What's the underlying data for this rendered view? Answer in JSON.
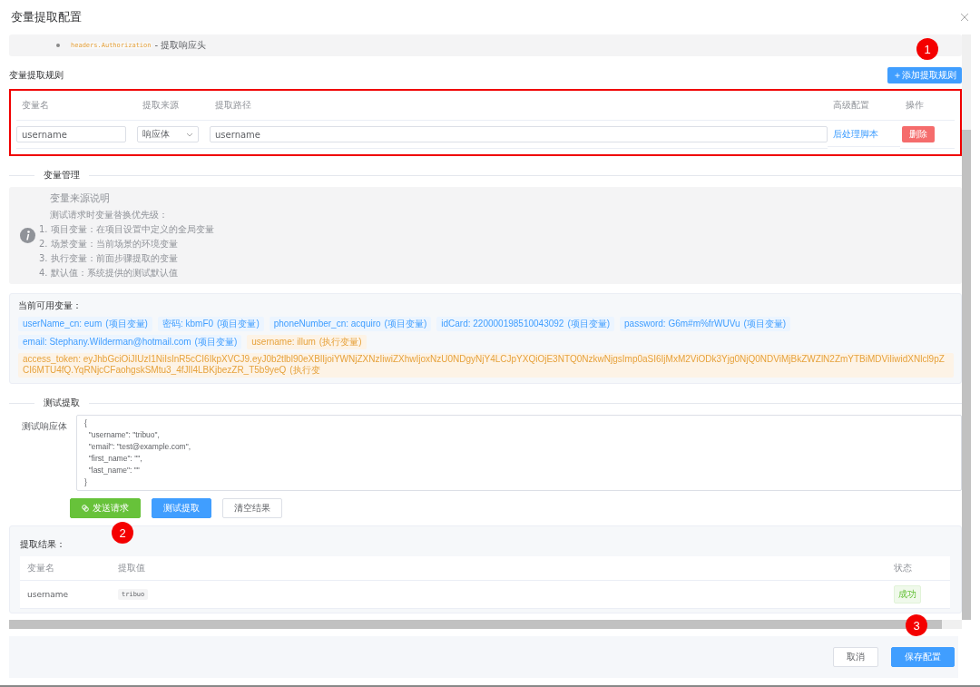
{
  "dialog": {
    "title": "变量提取配置"
  },
  "hint": {
    "code": "headers.Authorization",
    "text": "- 提取响应头"
  },
  "rules": {
    "title": "变量提取规则",
    "add_button": "＋添加提取规则",
    "columns": [
      "变量名",
      "提取来源",
      "提取路径",
      "高级配置",
      "操作"
    ],
    "rows": [
      {
        "name": "username",
        "source": "响应体",
        "path": "username",
        "script_link": "后处理脚本",
        "delete_button": "删除"
      }
    ]
  },
  "variables_section": {
    "title": "变量管理",
    "info": {
      "title": "变量来源说明",
      "lead": "测试请求时变量替换优先级：",
      "items": [
        "1. 项目变量：在项目设置中定义的全局变量",
        "2. 场景变量：当前场景的环境变量",
        "3. 执行变量：前面步骤提取的变量",
        "4. 默认值：系统提供的测试默认值"
      ]
    },
    "available": {
      "label": "当前可用变量：",
      "tags": [
        {
          "kind": "project",
          "text": "userName_cn: eum",
          "scope": "(项目变量)"
        },
        {
          "kind": "project",
          "text": "密码: kbmF0",
          "scope": "(项目变量)"
        },
        {
          "kind": "project",
          "text": "phoneNumber_cn: acquiro",
          "scope": "(项目变量)"
        },
        {
          "kind": "project",
          "text": "idCard: 220000198510043092",
          "scope": "(项目变量)"
        },
        {
          "kind": "project",
          "text": "password: G6m#m%frWUVu",
          "scope": "(项目变量)"
        },
        {
          "kind": "project",
          "text": "email: Stephany.Wilderman@hotmail.com",
          "scope": "(项目变量)"
        },
        {
          "kind": "exec",
          "text": "username: illum",
          "scope": "(执行变量)"
        },
        {
          "kind": "exec",
          "text": "access_token: eyJhbGciOiJIUzI1NiIsInR5cCI6IkpXVCJ9.eyJ0b2tlbl90eXBlIjoiYWNjZXNzIiwiZXhwIjoxNzU0NDgyNjY4LCJpYXQiOjE3NTQ0NzkwNjgsImp0aSI6IjMxM2ViODk3Yjg0NjQ0NDViMjBkZWZlN2ZmYTBiMDViIiwidXNlcl9pZCI6MTU4fQ.YqRNjcCFaohgskSMtu3_4fJlI4LBKjbezZR_T5b9yeQ",
          "scope": "(执行变"
        }
      ]
    }
  },
  "test_section": {
    "title": "测试提取",
    "body_label": "测试响应体",
    "body": "{\n  \"username\": \"tribuo\",\n  \"email\": \"test@example.com\",\n  \"first_name\": \"\",\n  \"last_name\": \"\"\n}",
    "buttons": [
      {
        "kind": "success",
        "label": "发送请求"
      },
      {
        "kind": "primary",
        "label": "测试提取"
      },
      {
        "kind": "default",
        "label": "清空结果"
      }
    ],
    "results": {
      "label": "提取结果：",
      "columns": [
        "变量名",
        "提取值",
        "状态"
      ],
      "rows": [
        {
          "name": "username",
          "value": "tribuo",
          "status": "成功"
        }
      ]
    }
  },
  "footer": {
    "buttons": [
      {
        "kind": "default",
        "label": "取消"
      },
      {
        "kind": "primary",
        "label": "保存配置"
      }
    ]
  },
  "annotations": [
    "1",
    "2",
    "3"
  ]
}
